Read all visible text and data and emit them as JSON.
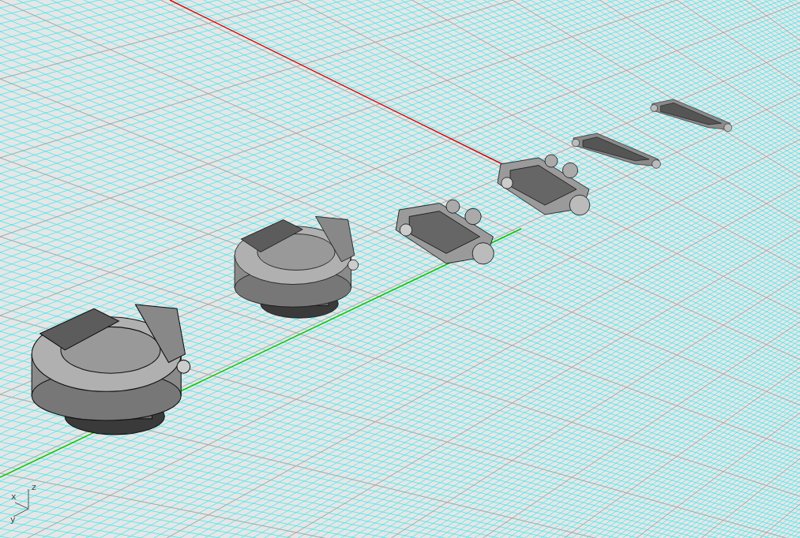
{
  "viewport": {
    "axis_gizmo": {
      "x_label": "x",
      "y_label": "y",
      "z_label": "z"
    }
  }
}
